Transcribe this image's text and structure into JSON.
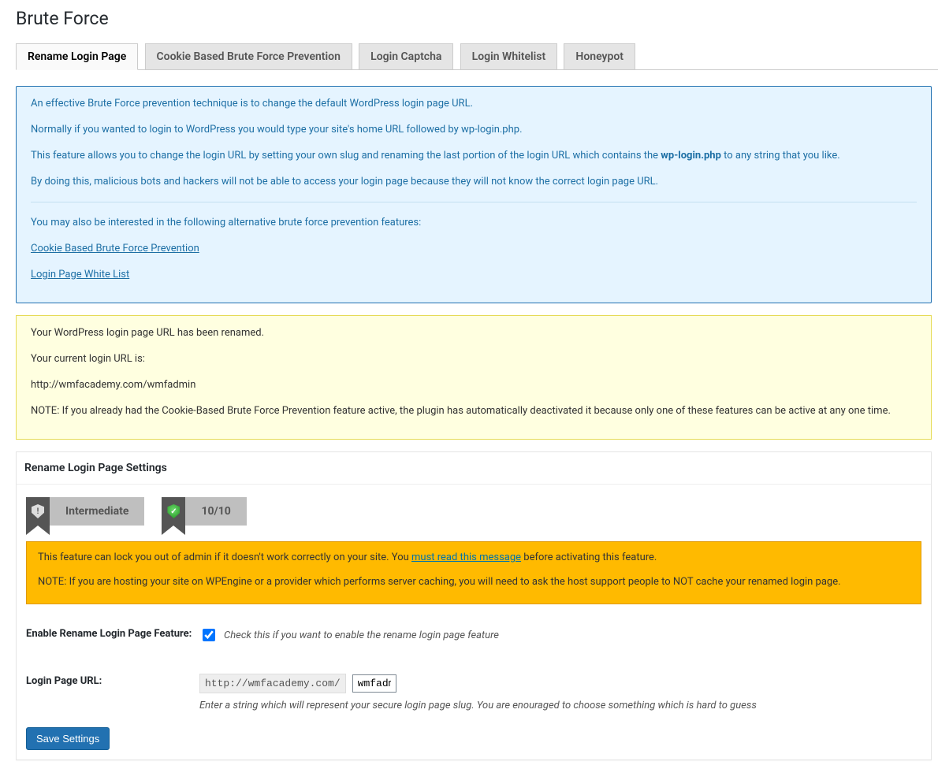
{
  "page": {
    "title": "Brute Force"
  },
  "tabs": [
    {
      "label": "Rename Login Page",
      "active": true
    },
    {
      "label": "Cookie Based Brute Force Prevention",
      "active": false
    },
    {
      "label": "Login Captcha",
      "active": false
    },
    {
      "label": "Login Whitelist",
      "active": false
    },
    {
      "label": "Honeypot",
      "active": false
    }
  ],
  "info_box": {
    "p1": "An effective Brute Force prevention technique is to change the default WordPress login page URL.",
    "p2": "Normally if you wanted to login to WordPress you would type your site's home URL followed by wp-login.php.",
    "p3_before": "This feature allows you to change the login URL by setting your own slug and renaming the last portion of the login URL which contains the ",
    "p3_strong": "wp-login.php",
    "p3_after": " to any string that you like.",
    "p4": "By doing this, malicious bots and hackers will not be able to access your login page because they will not know the correct login page URL.",
    "alt_header": "You may also be interested in the following alternative brute force prevention features:",
    "links": [
      "Cookie Based Brute Force Prevention",
      "Login Page White List"
    ]
  },
  "status_box": {
    "p1": "Your WordPress login page URL has been renamed.",
    "p2": "Your current login URL is:",
    "p3": "http://wmfacademy.com/wmfadmin",
    "p4": "NOTE: If you already had the Cookie-Based Brute Force Prevention feature active, the plugin has automatically deactivated it because only one of these features can be active at any one time."
  },
  "settings_panel": {
    "title": "Rename Login Page Settings",
    "badges": {
      "level": "Intermediate",
      "score": "10/10"
    },
    "warning": {
      "p1_before": "This feature can lock you out of admin if it doesn't work correctly on your site. You ",
      "p1_link": "must read this message",
      "p1_after": " before activating this feature.",
      "p2": "NOTE: If you are hosting your site on WPEngine or a provider which performs server caching, you will need to ask the host support people to NOT cache your renamed login page."
    },
    "fields": {
      "enable": {
        "label": "Enable Rename Login Page Feature:",
        "checked": true,
        "desc": "Check this if you want to enable the rename login page feature"
      },
      "url": {
        "label": "Login Page URL:",
        "prefix": "http://wmfacademy.com/",
        "value": "wmfadmin",
        "desc": "Enter a string which will represent your secure login page slug. You are enouraged to choose something which is hard to guess"
      }
    },
    "save_button": "Save Settings"
  }
}
